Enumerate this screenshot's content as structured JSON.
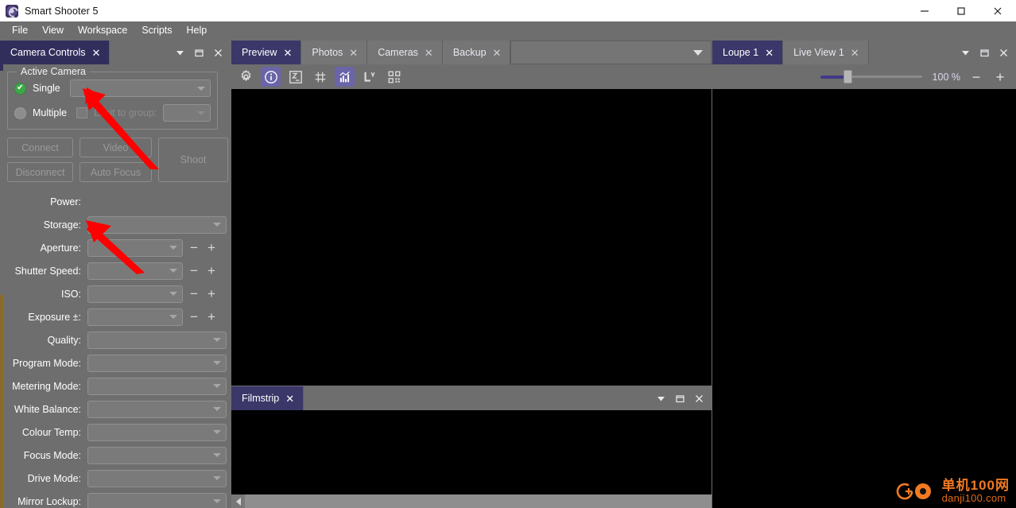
{
  "window": {
    "title": "Smart Shooter 5",
    "logo_icon": "smart-shooter-logo-icon",
    "minimize_label": "—",
    "maximize_label": "□",
    "close_label": "✕"
  },
  "menubar": {
    "items": [
      {
        "label": "File"
      },
      {
        "label": "View"
      },
      {
        "label": "Workspace"
      },
      {
        "label": "Scripts"
      },
      {
        "label": "Help"
      }
    ]
  },
  "left_dock": {
    "tabs": [
      {
        "label": "Camera Controls",
        "active": true,
        "close": "✕"
      }
    ],
    "controls": {
      "collapse": "▼",
      "float": "❐",
      "close": "✕"
    },
    "active_camera": {
      "group_title": "Active Camera",
      "single_label": "Single",
      "single_checked": true,
      "single_check_glyph": "✔",
      "multiple_label": "Multiple",
      "multiple_checked": false,
      "limit_to_group_label": "Limit to group:",
      "limit_to_group_checked": false
    },
    "buttons": {
      "connect": "Connect",
      "disconnect": "Disconnect",
      "video": "Video",
      "auto_focus": "Auto Focus",
      "shoot": "Shoot"
    },
    "fields": [
      {
        "label": "Power:",
        "type": "text",
        "value": ""
      },
      {
        "label": "Storage:",
        "type": "combo-long",
        "value": ""
      },
      {
        "label": "Aperture:",
        "type": "combo-stepper",
        "value": ""
      },
      {
        "label": "Shutter Speed:",
        "type": "combo-stepper",
        "value": ""
      },
      {
        "label": "ISO:",
        "type": "combo-stepper",
        "value": ""
      },
      {
        "label": "Exposure ±:",
        "type": "combo-stepper",
        "value": ""
      },
      {
        "label": "Quality:",
        "type": "combo-long",
        "value": ""
      },
      {
        "label": "Program Mode:",
        "type": "combo-long",
        "value": ""
      },
      {
        "label": "Metering Mode:",
        "type": "combo-long",
        "value": ""
      },
      {
        "label": "White Balance:",
        "type": "combo-long",
        "value": ""
      },
      {
        "label": "Colour Temp:",
        "type": "combo-long",
        "value": ""
      },
      {
        "label": "Focus Mode:",
        "type": "combo-long",
        "value": ""
      },
      {
        "label": "Drive Mode:",
        "type": "combo-long",
        "value": ""
      },
      {
        "label": "Mirror Lockup:",
        "type": "combo-long",
        "value": ""
      }
    ],
    "stepper": {
      "minus": "−",
      "plus": "+"
    }
  },
  "center_dock": {
    "preview_tabs": [
      {
        "label": "Preview",
        "active": true,
        "close": "✕"
      },
      {
        "label": "Photos",
        "active": false,
        "close": "✕"
      },
      {
        "label": "Cameras",
        "active": false,
        "close": "✕"
      },
      {
        "label": "Backup",
        "active": false,
        "close": "✕"
      }
    ],
    "tabbar_overflow_icon": "chevron-down-icon",
    "toolbar": [
      {
        "name": "settings-gear-icon",
        "active": false
      },
      {
        "name": "info-circle-icon",
        "active": true
      },
      {
        "name": "exposure-compensation-icon",
        "active": false
      },
      {
        "name": "grid-overlay-icon",
        "active": false
      },
      {
        "name": "histogram-chart-icon",
        "active": true
      },
      {
        "name": "live-view-icon",
        "active": false
      },
      {
        "name": "qr-code-icon",
        "active": false
      }
    ],
    "filmstrip_tabs": [
      {
        "label": "Filmstrip",
        "active": true,
        "close": "✕"
      }
    ],
    "filmstrip_controls": {
      "collapse": "▼",
      "float": "❐",
      "close": "✕"
    },
    "scroll_left_icon": "scroll-left-arrow-icon"
  },
  "right_dock": {
    "tabs": [
      {
        "label": "Loupe 1",
        "active": true,
        "close": "✕"
      },
      {
        "label": "Live View 1",
        "active": false,
        "close": "✕"
      }
    ],
    "controls": {
      "collapse": "▼",
      "float": "❐",
      "close": "✕"
    },
    "zoom": {
      "value_label": "100 %",
      "zoom_out": "−",
      "zoom_in": "+",
      "slider_percent": 25
    }
  },
  "annotations": {
    "arrows": [
      {
        "name": "arrow-pointing-to-active-camera-combo"
      },
      {
        "name": "arrow-pointing-to-aperture-combo"
      }
    ]
  },
  "watermark": {
    "cn_text": "单机100网",
    "en_text": "danji100.com",
    "logo_icon": "danji100-logo-icon",
    "color": "#f07a23"
  },
  "colors": {
    "accent": "#3b3769",
    "toolbar_active": "#6a64a8",
    "panel_bg": "#6e6e6e",
    "canvas_bg": "#000000",
    "check_green": "#3fa94a"
  }
}
